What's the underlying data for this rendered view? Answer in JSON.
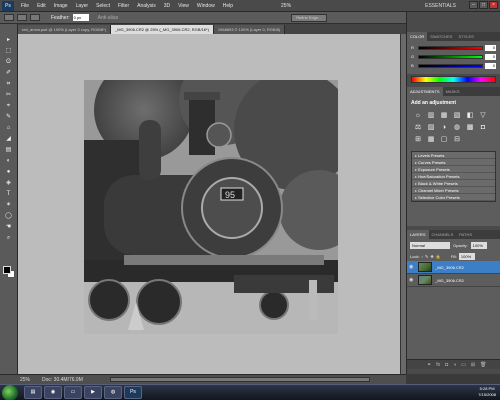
{
  "menu": [
    "File",
    "Edit",
    "Image",
    "Layer",
    "Select",
    "Filter",
    "Analysis",
    "3D",
    "View",
    "Window",
    "Help"
  ],
  "zoom_menu": "25%",
  "workspace": "ESSENTIALS",
  "options": {
    "feather_label": "Feather:",
    "feather_value": "0 px",
    "anti_alias": "Anti-alias",
    "refine_edge": "Refine Edge..."
  },
  "tabs": [
    "red_arrow.psd @ 100% (Layer 3 copy, RGB/8*)",
    "_MG_3906.CR2 @ 25% (_MG_3906.CR2, RGB/16*)",
    "1968893 © 100% (Layer 0, RGB/8)"
  ],
  "tools": [
    "▸",
    "⬚",
    "ʘ",
    "✐",
    "⌗",
    "✂",
    "⌖",
    "✎",
    "⌂",
    "◢",
    "▤",
    "◐",
    "●",
    "◈",
    "T",
    "✶",
    "◯",
    "☚",
    "⌕"
  ],
  "status": {
    "zoom": "25%",
    "doc": "Doc: 30.4M/76.9M"
  },
  "color_panel": {
    "tabs": [
      "COLOR",
      "SWATCHES",
      "STYLES"
    ],
    "channels": [
      {
        "label": "R",
        "value": "0"
      },
      {
        "label": "G",
        "value": "0"
      },
      {
        "label": "B",
        "value": "0"
      }
    ]
  },
  "adjustments_panel": {
    "tabs": [
      "ADJUSTMENTS",
      "MASKS"
    ],
    "title": "Add an adjustment",
    "icons": [
      "☼",
      "▥",
      "▦",
      "▧",
      "◧",
      "▽",
      "⚖",
      "▨",
      "◑",
      "◍",
      "▩",
      "◘",
      "⊞",
      "▦",
      "▢",
      "⊟"
    ],
    "presets": [
      "Levels Presets",
      "Curves Presets",
      "Exposure Presets",
      "Hue/Saturation Presets",
      "Black & White Presets",
      "Channel Mixer Presets",
      "Selective Color Presets"
    ]
  },
  "layers_panel": {
    "tabs": [
      "LAYERS",
      "CHANNELS",
      "PATHS"
    ],
    "blend_mode": "Normal",
    "opacity_label": "Opacity:",
    "opacity_value": "100%",
    "lock_label": "Lock:",
    "fill_label": "Fill:",
    "fill_value": "100%",
    "layers": [
      {
        "name": "_MG_3906.CR2",
        "selected": true
      },
      {
        "name": "_MG_3906.CR2",
        "selected": false
      }
    ]
  },
  "taskbar": {
    "time": "5:28 PM",
    "date": "7/15/2008"
  }
}
